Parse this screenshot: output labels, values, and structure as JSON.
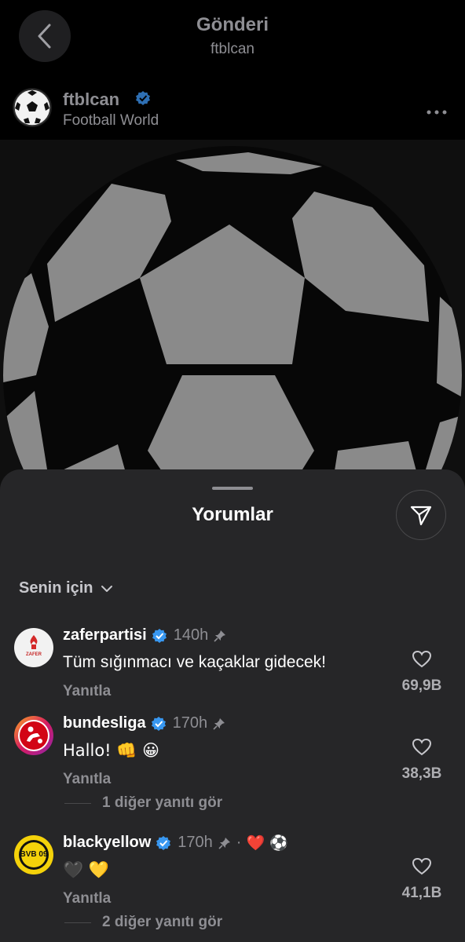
{
  "header": {
    "title": "Gönderi",
    "subtitle": "ftblcan"
  },
  "author": {
    "name": "ftblcan",
    "verified": true,
    "subtitle": "Football World"
  },
  "comments_sheet": {
    "title": "Yorumlar",
    "filter_label": "Senin için",
    "reply_label": "Yanıtla",
    "comments": [
      {
        "username": "zaferpartisi",
        "verified": true,
        "time": "140h",
        "pinned": true,
        "text": "Tüm sığınmacı ve kaçaklar gidecek!",
        "likes": "69,9B",
        "avatar_text": "ZAFER"
      },
      {
        "username": "bundesliga",
        "verified": true,
        "time": "170h",
        "pinned": true,
        "text": "Hallo! 👊 😀",
        "likes": "38,3B",
        "more_replies": "1 diğer yanıtı gör"
      },
      {
        "username": "blackyellow",
        "verified": true,
        "time": "170h",
        "pinned": true,
        "extra": "❤️ ⚽",
        "text": "🖤 💛",
        "likes": "41,1B",
        "more_replies": "2 diğer yanıtı gör",
        "avatar_text": "BVB 09"
      }
    ]
  },
  "colors": {
    "background": "#000000",
    "sheet": "#262628",
    "muted": "#8e8e93",
    "verified": "#3897f0",
    "ball_panel": "#8c8c8c"
  }
}
